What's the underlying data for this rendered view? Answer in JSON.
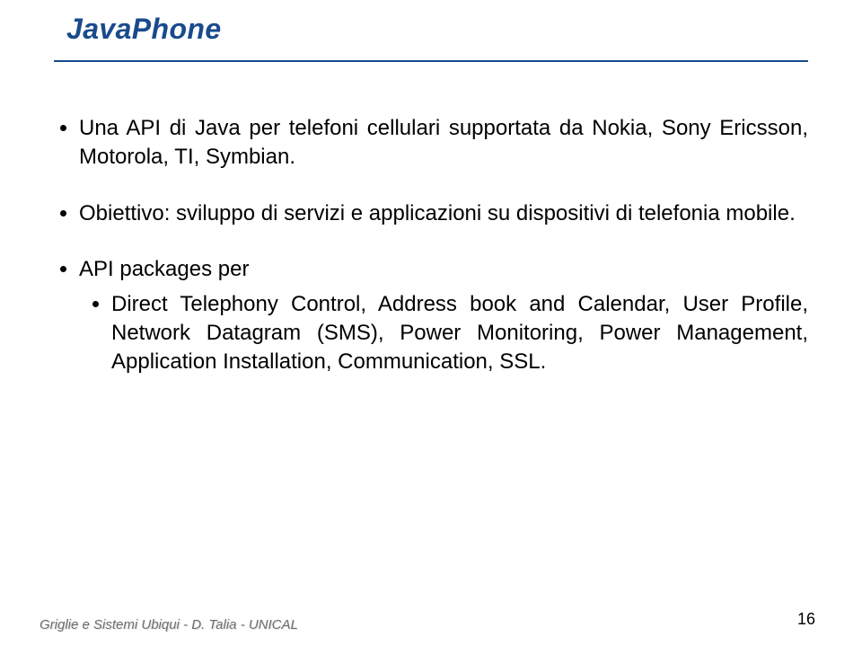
{
  "title": "JavaPhone",
  "bullets": {
    "b1": "Una API di Java per telefoni cellulari supportata da Nokia, Sony Ericsson, Motorola, TI, Symbian.",
    "b2": "Obiettivo: sviluppo di servizi e applicazioni su dispositivi di telefonia mobile.",
    "b3": "API packages per",
    "b3_sub1": "Direct Telephony Control, Address book and Calendar, User Profile, Network Datagram (SMS), Power Monitoring, Power Management, Application Installation, Communication, SSL."
  },
  "footer": "Griglie e Sistemi Ubiqui - D. Talia - UNICAL",
  "page_number": "16"
}
